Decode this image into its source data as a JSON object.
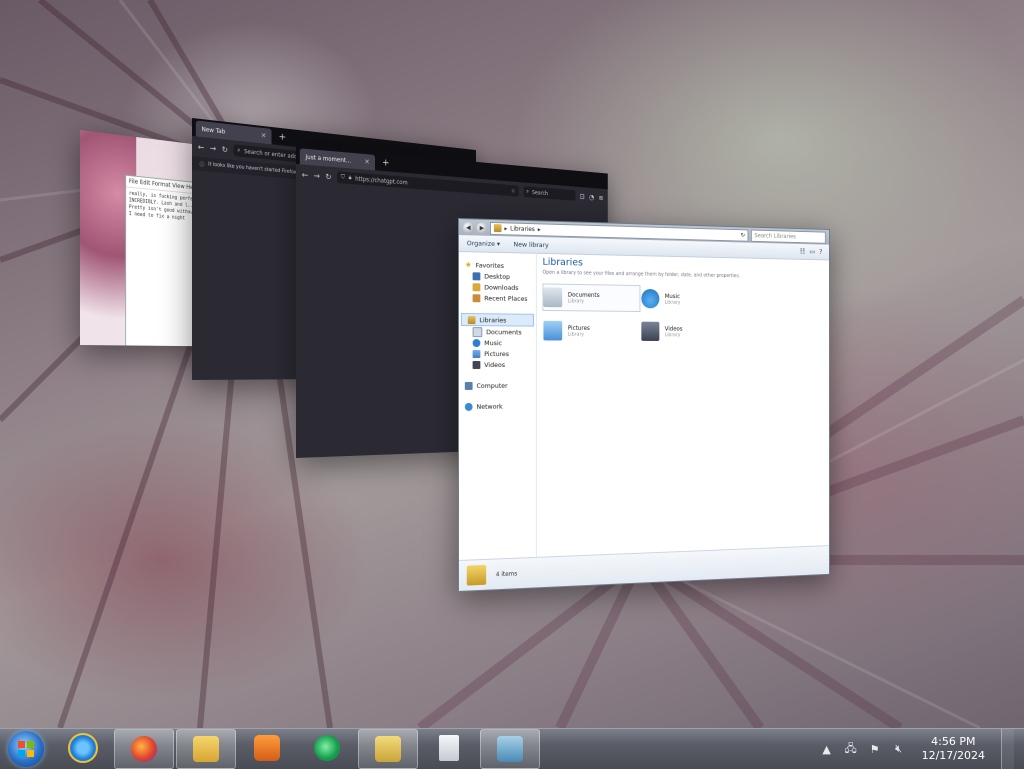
{
  "notepad": {
    "menu": "File  Edit  Format  View  Help",
    "lines": [
      "really, is fucking perfect",
      "INCREDIBLY. Lash and l...",
      "",
      "Pretty isn't good without",
      "I need to fix a night"
    ]
  },
  "firefox_back": {
    "tab_title": "New Tab",
    "url_placeholder": "Search or enter address",
    "notice": "It looks like you haven't started Firefox in a while..."
  },
  "firefox_front": {
    "tab_title": "Just a moment...",
    "url": "https://chatgpt.com",
    "search_placeholder": "Search"
  },
  "explorer": {
    "address": "Libraries",
    "search_placeholder": "Search Libraries",
    "toolbar": {
      "organize": "Organize ▾",
      "new_library": "New library"
    },
    "nav": {
      "favorites": "Favorites",
      "desktop": "Desktop",
      "downloads": "Downloads",
      "recent_places": "Recent Places",
      "libraries": "Libraries",
      "documents": "Documents",
      "music": "Music",
      "pictures": "Pictures",
      "videos": "Videos",
      "computer": "Computer",
      "network": "Network"
    },
    "content": {
      "title": "Libraries",
      "subtitle": "Open a library to see your files and arrange them by folder, date, and other properties.",
      "items": [
        {
          "name": "Documents",
          "kind": "Library"
        },
        {
          "name": "Music",
          "kind": "Library"
        },
        {
          "name": "Pictures",
          "kind": "Library"
        },
        {
          "name": "Videos",
          "kind": "Library"
        }
      ]
    },
    "status": "4 items"
  },
  "taskbar": {
    "time": "4:56 PM",
    "date": "12/17/2024",
    "icons": [
      "start-orb",
      "internet-explorer-icon",
      "firefox-icon",
      "windows-explorer-icon",
      "media-player-icon",
      "media-center-icon",
      "folder-icon",
      "document-icon",
      "notepad-icon"
    ],
    "tray_icons": [
      "show-hidden-icons",
      "network-icon",
      "action-center-flag-icon",
      "volume-muted-icon"
    ]
  }
}
